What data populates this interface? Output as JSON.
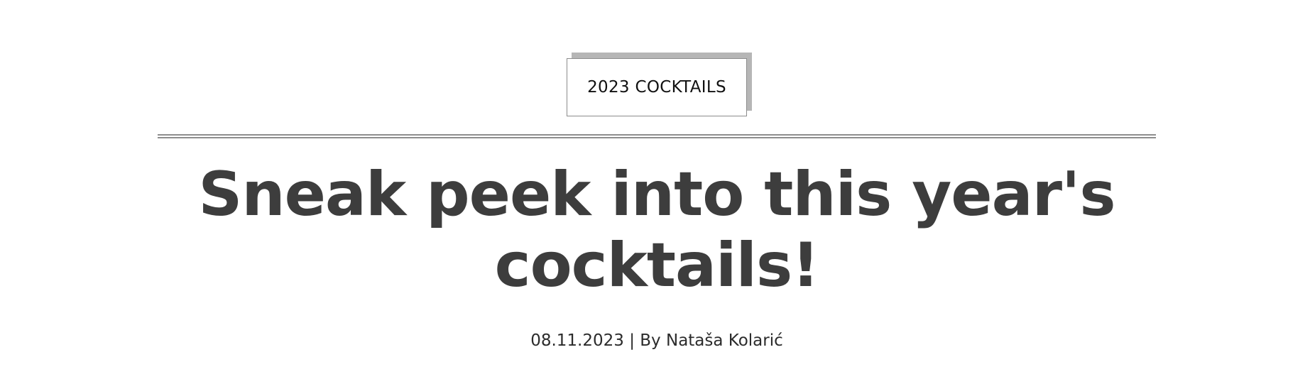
{
  "article": {
    "category": "2023 COCKTAILS",
    "title": "Sneak peek into this year's cocktails!",
    "date": "08.11.2023",
    "separator": "|",
    "author_prefix": "By",
    "author": "Nataša Kolarić"
  },
  "colors": {
    "title": "#3d3d3d",
    "tag_shadow": "#b6b6b6",
    "divider": "#8e8e8e"
  }
}
